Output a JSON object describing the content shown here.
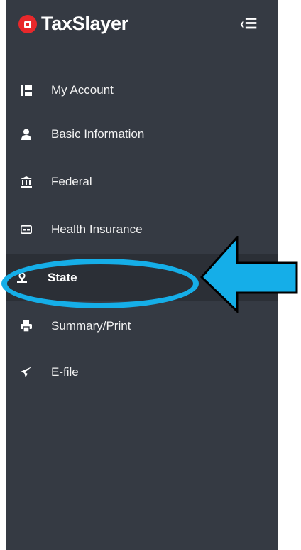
{
  "brand": {
    "name": "TaxSlayer",
    "collapse_glyph": "‹☰"
  },
  "nav": {
    "items": [
      {
        "label": "My Account",
        "icon": "account-card-icon"
      },
      {
        "label": "Basic Information",
        "icon": "person-icon"
      },
      {
        "label": "Federal",
        "icon": "bank-building-icon"
      },
      {
        "label": "Health Insurance",
        "icon": "insurance-card-icon"
      },
      {
        "label": "State",
        "icon": "map-pin-icon",
        "active": true
      },
      {
        "label": "Summary/Print",
        "icon": "printer-icon"
      },
      {
        "label": "E-file",
        "icon": "paper-plane-icon"
      }
    ]
  },
  "colors": {
    "sidebar": "#353a43",
    "active_row": "#2b2f36",
    "accent_annotation": "#15aee8",
    "brand_red": "#e8282b"
  }
}
